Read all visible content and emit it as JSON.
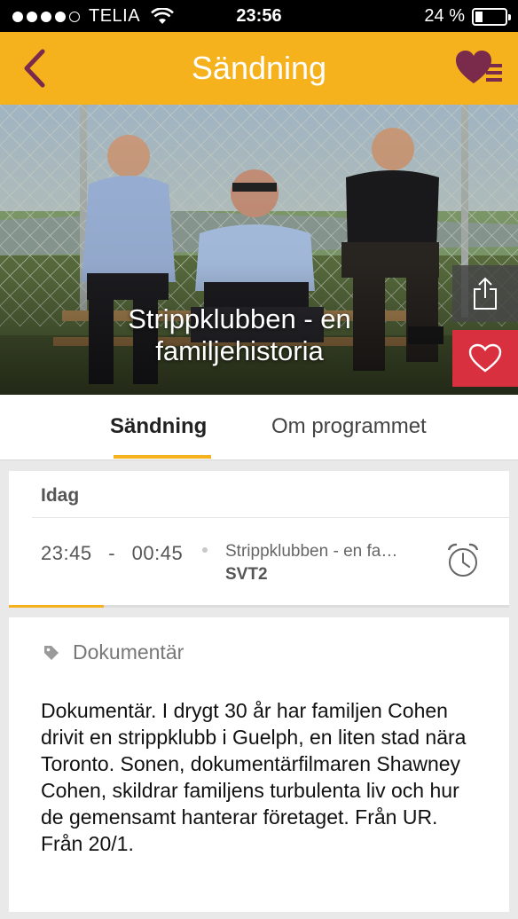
{
  "status_bar": {
    "carrier": "TELIA",
    "time": "23:56",
    "battery": "24 %",
    "battery_level": 0.24
  },
  "nav": {
    "title": "Sändning"
  },
  "hero": {
    "title": "Strippklubben - en familjehistoria"
  },
  "tabs": [
    {
      "label": "Sändning",
      "active": true
    },
    {
      "label": "Om programmet",
      "active": false
    }
  ],
  "schedule": {
    "day": "Idag",
    "start": "23:45",
    "separator": "-",
    "end": "00:45",
    "program_title": "Strippklubben - en fa…",
    "channel": "SVT2",
    "progress": 0.19
  },
  "details": {
    "genre": "Dokumentär",
    "description": "Dokumentär. I drygt 30 år har familjen Cohen drivit en strippklubb i Guelph, en liten stad nära Toronto. Sonen, dokumentärfilmaren Shawney Cohen, skildrar familjens turbulenta liv och hur de gemensamt hanterar företaget. Från UR. Från 20/1."
  },
  "colors": {
    "accent": "#f5b21d",
    "favorite": "#d93040",
    "back_arrow": "#7a2a4a"
  }
}
